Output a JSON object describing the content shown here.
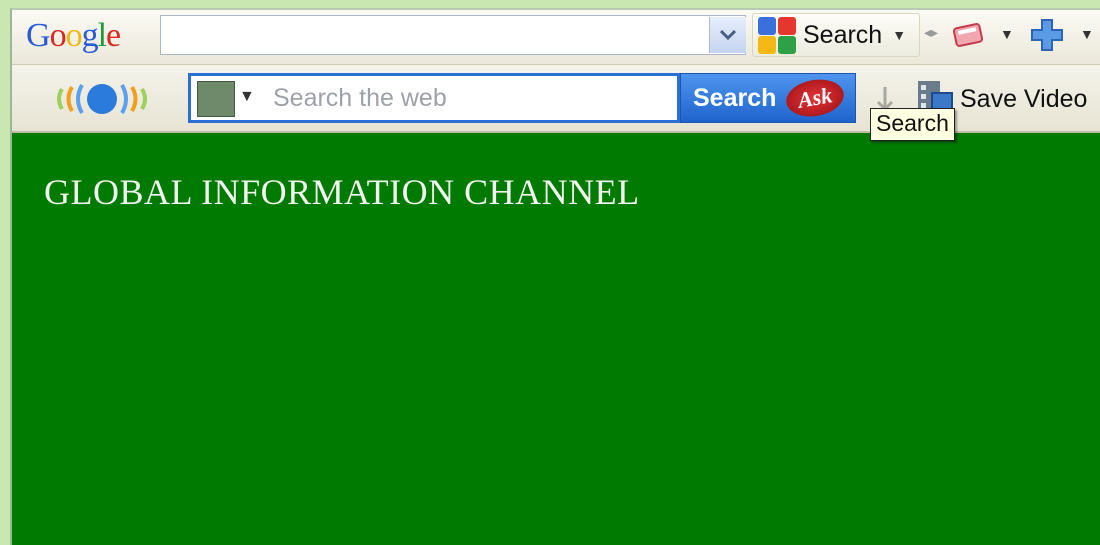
{
  "google_toolbar": {
    "logo_letters": [
      "G",
      "o",
      "o",
      "g",
      "l",
      "e"
    ],
    "search_value": "",
    "search_button_label": "Search",
    "icons": [
      "search-dropdown-icon",
      "google-g-icon",
      "arrows-icon",
      "bookmarks-icon",
      "add-plus-icon"
    ]
  },
  "ask_toolbar": {
    "search_placeholder": "Search the web",
    "search_button_label": "Search",
    "ask_logo_text": "Ask",
    "save_video_label": "Save Video",
    "tooltip": "Search"
  },
  "page": {
    "headline": "GLOBAL INFORMATION CHANNEL",
    "background_color": "#007a00"
  }
}
